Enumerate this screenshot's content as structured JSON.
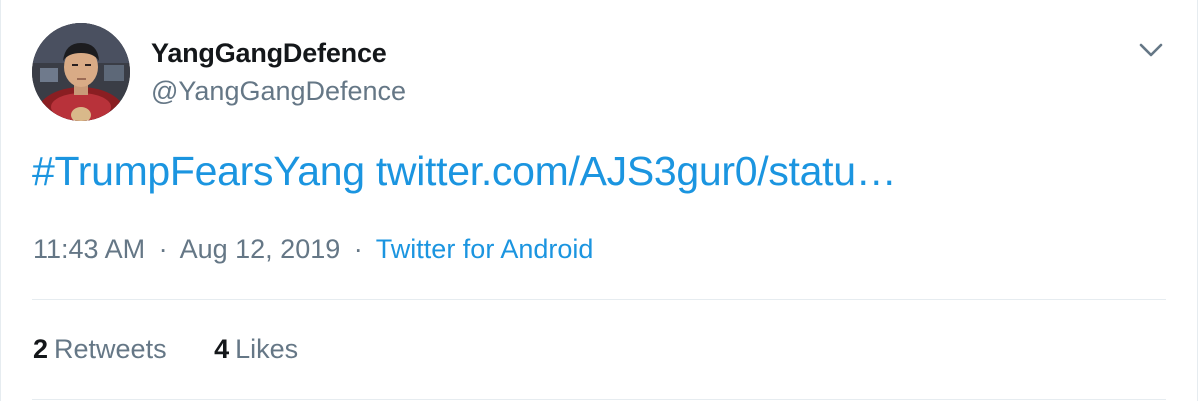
{
  "author": {
    "display_name": "YangGangDefence",
    "handle": "@YangGangDefence",
    "avatar_icon": "profile-photo-avatar"
  },
  "tweet": {
    "hashtag": "#TrumpFearsYang",
    "link": "twitter.com/AJS3gur0/statu…"
  },
  "meta": {
    "time": "11:43 AM",
    "date": "Aug 12, 2019",
    "separator": "·",
    "source": "Twitter for Android"
  },
  "stats": {
    "retweets_count": "2",
    "retweets_label": "Retweets",
    "likes_count": "4",
    "likes_label": "Likes"
  },
  "icons": {
    "menu": "chevron-down-icon"
  },
  "colors": {
    "link": "#1b95e0",
    "secondary_text": "#657786",
    "primary_text": "#14171a",
    "divider": "#e6ecf0"
  }
}
